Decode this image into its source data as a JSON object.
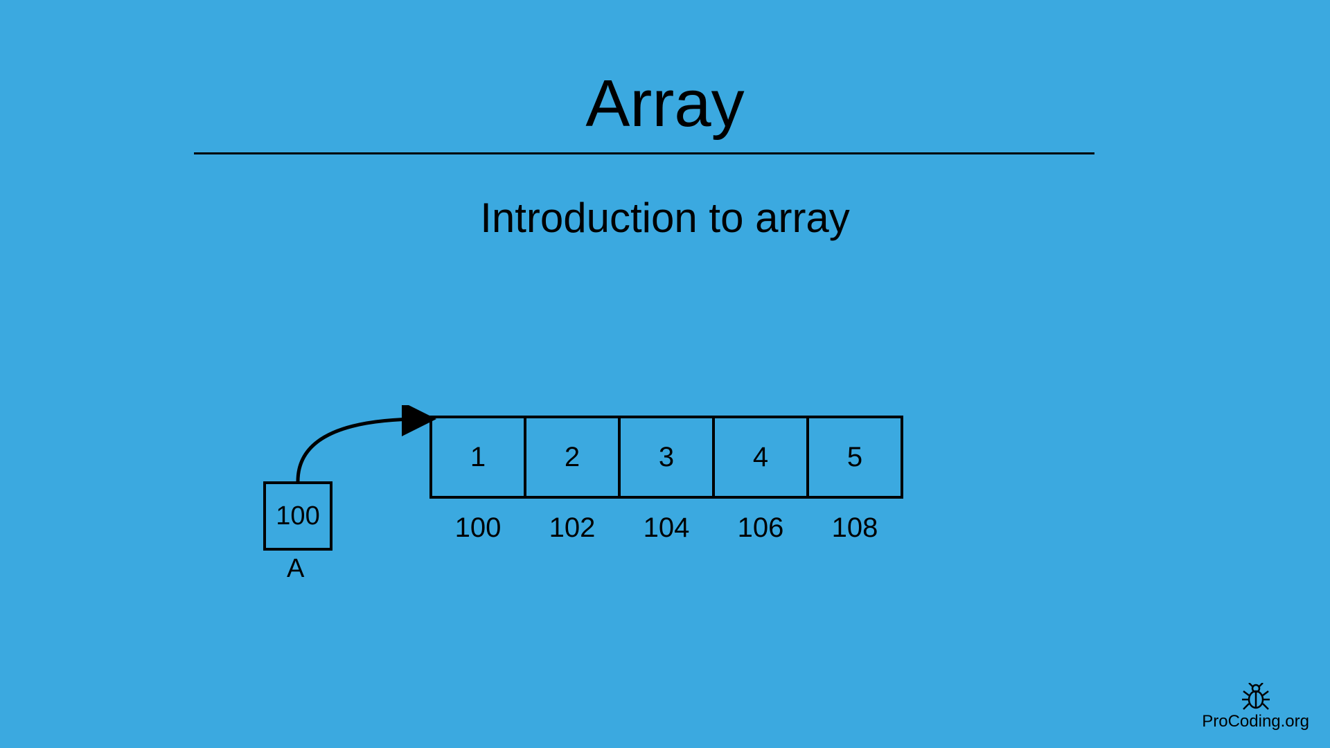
{
  "title": "Array",
  "subtitle": "Introduction to array",
  "pointer": {
    "value": "100",
    "label": "A"
  },
  "array": {
    "cells": [
      "1",
      "2",
      "3",
      "4",
      "5"
    ],
    "addresses": [
      "100",
      "102",
      "104",
      "106",
      "108"
    ]
  },
  "logo_text": "ProCoding.org"
}
